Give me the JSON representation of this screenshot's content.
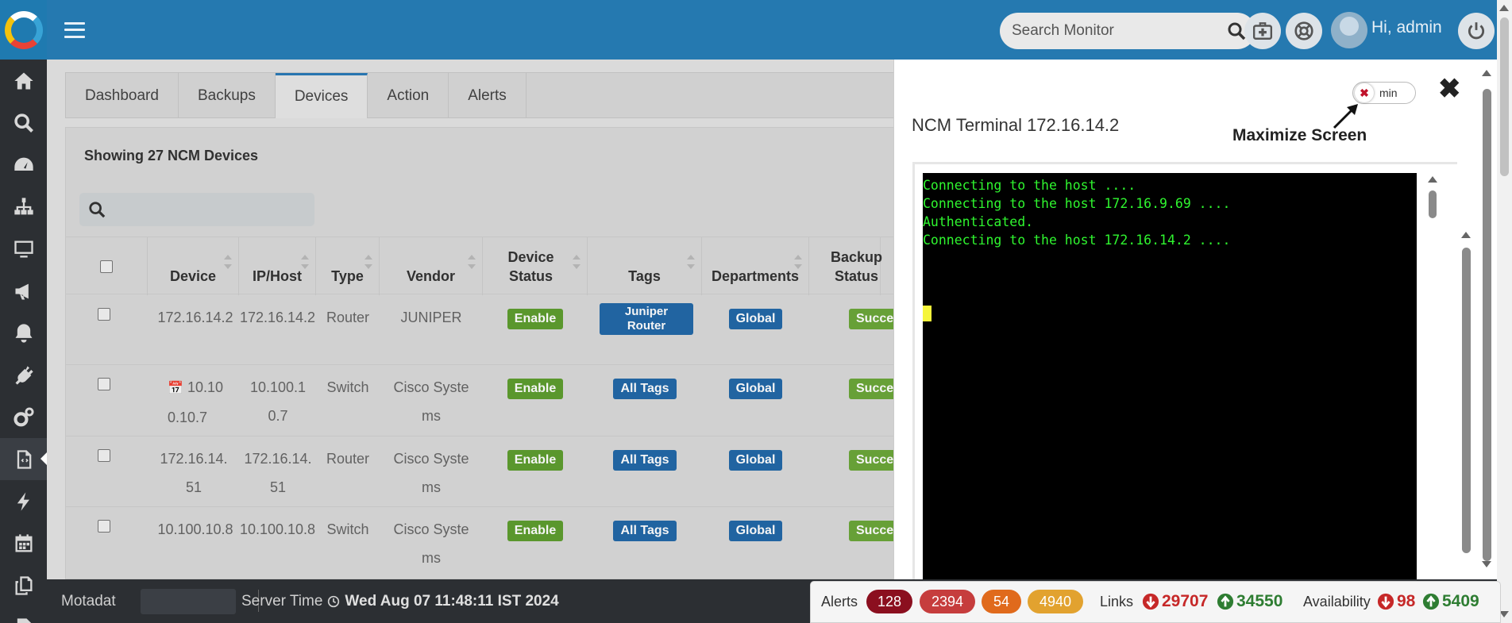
{
  "sidebar": {
    "icons": [
      "home-icon",
      "search-icon",
      "dashboard-icon",
      "topology-icon",
      "monitor-icon",
      "megaphone-icon",
      "bell-icon",
      "plug-icon",
      "settings-icon",
      "ncm-icon",
      "lightning-icon",
      "calendar-icon",
      "copy-icon",
      "file-icon"
    ]
  },
  "topbar": {
    "search_placeholder": "Search Monitor",
    "greeting": "Hi, admin"
  },
  "tabs": [
    {
      "label": "Dashboard"
    },
    {
      "label": "Backups"
    },
    {
      "label": "Devices",
      "active": true
    },
    {
      "label": "Action"
    },
    {
      "label": "Alerts"
    }
  ],
  "devices": {
    "showing": "Showing 27 NCM Devices",
    "columns": [
      "Device",
      "IP/Host",
      "Type",
      "Vendor",
      "Device Status",
      "Tags",
      "Departments",
      "Backup Status"
    ],
    "rows": [
      {
        "device": "172.16.14.2",
        "ip": "172.16.14.2",
        "type": "Router",
        "vendor": "JUNIPER",
        "status": "Enable",
        "tags": "Juniper Router",
        "department": "Global",
        "backup": "Success"
      },
      {
        "device": "10.100.10.7",
        "ip": "10.100.10.7",
        "type": "Switch",
        "vendor": "Cisco Systems",
        "status": "Enable",
        "tags": "All Tags",
        "department": "Global",
        "backup": "Success"
      },
      {
        "device": "172.16.14.51",
        "ip": "172.16.14.51",
        "type": "Router",
        "vendor": "Cisco Systems",
        "status": "Enable",
        "tags": "All Tags",
        "department": "Global",
        "backup": "Success"
      },
      {
        "device": "10.100.10.8",
        "ip": "10.100.10.8",
        "type": "Switch",
        "vendor": "Cisco Systems",
        "status": "Enable",
        "tags": "All Tags",
        "department": "Global",
        "backup": "Success"
      }
    ]
  },
  "modal": {
    "title": "NCM Terminal 172.16.14.2",
    "toggle_label": "min",
    "annotation": "Maximize Screen",
    "terminal_lines": [
      "Connecting to the host ....",
      "Connecting to the host 172.16.9.69 ....",
      "Authenticated.",
      "Connecting to the host 172.16.14.2 ...."
    ]
  },
  "footer": {
    "brand": "Motadat",
    "server_label": "Server Time",
    "server_time": "Wed Aug 07 11:48:11 IST 2024"
  },
  "status_bar": {
    "alerts_label": "Alerts",
    "alert_counts": [
      {
        "value": "128",
        "color": "#8b0f1f"
      },
      {
        "value": "2394",
        "color": "#c63d3d"
      },
      {
        "value": "54",
        "color": "#e06a1c"
      },
      {
        "value": "4940",
        "color": "#e2a22f"
      }
    ],
    "links_label": "Links",
    "links_down": "29707",
    "links_up": "34550",
    "availability_label": "Availability",
    "avail_down": "98",
    "avail_up": "5409",
    "down_color": "#c62828",
    "up_color": "#2e7d32"
  }
}
